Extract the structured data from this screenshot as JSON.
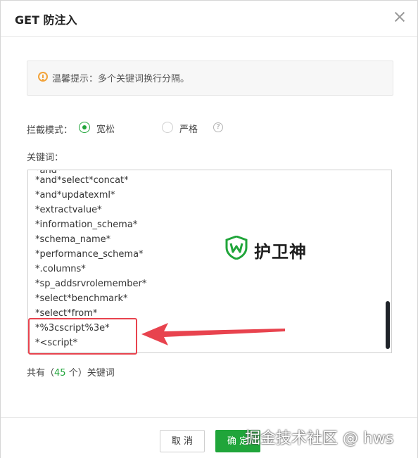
{
  "dialog": {
    "title": "GET 防注入",
    "close_icon": "close-icon"
  },
  "tip": {
    "icon": "warning-circle-icon",
    "text": "温馨提示：多个关键词换行分隔。"
  },
  "mode": {
    "label": "拦截模式：",
    "options": [
      {
        "label": "宽松",
        "checked": true
      },
      {
        "label": "严格",
        "checked": false
      }
    ],
    "help_icon": "question-circle-icon",
    "help_glyph": "?"
  },
  "keywords": {
    "label": "关键词：",
    "lines": [
      "*and*select*concat*",
      "*and*updatexml*",
      "*extractvalue*",
      "*information_schema*",
      "*schema_name*",
      "*performance_schema*",
      "*.columns*",
      "*sp_addsrvrolemember*",
      "*select*benchmark*",
      "*select*from*",
      "*%3cscript%3e*",
      "*<script*"
    ]
  },
  "watermark": {
    "icon": "shield-w-icon",
    "text": "护卫神"
  },
  "count": {
    "prefix": "共有（",
    "number": "45",
    "suffix": " 个）关键词"
  },
  "footer": {
    "cancel_label": "取 消",
    "ok_label": "确 定"
  },
  "credit": "掘金技术社区 @ hws",
  "colors": {
    "accent": "#20a53a",
    "highlight": "#e8434e",
    "warning": "#f2a33a"
  }
}
